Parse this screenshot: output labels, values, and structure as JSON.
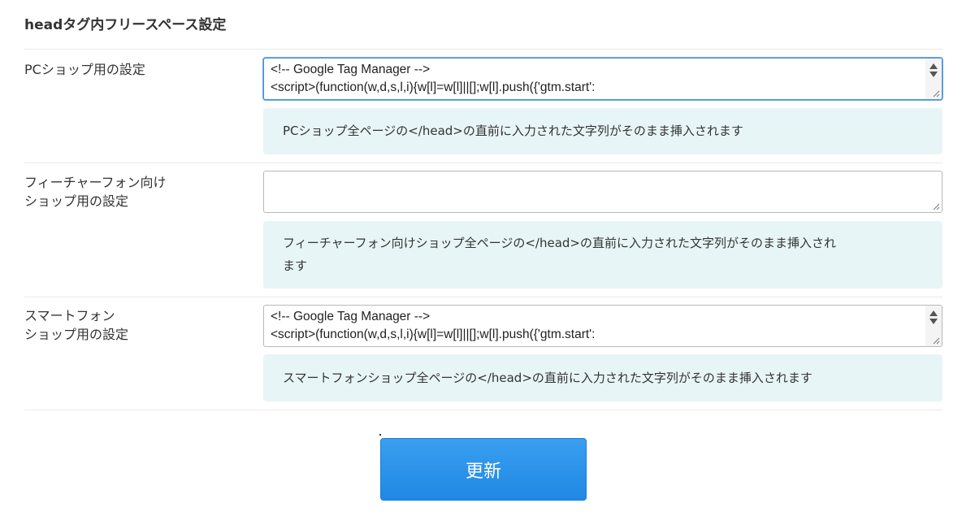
{
  "section": {
    "title": "headタグ内フリースペース設定"
  },
  "rows": [
    {
      "label": "PCショップ用の設定",
      "textarea_lines": [
        "<!-- Google Tag Manager -->",
        "<script>(function(w,d,s,l,i){w[l]=w[l]||[];w[l].push({'gtm.start':"
      ],
      "help": "PCショップ全ページの</head>の直前に入力された文字列がそのまま挿入されます"
    },
    {
      "label": "フィーチャーフォン向け\nショップ用の設定",
      "textarea_lines": [],
      "help_lines": [
        "フィーチャーフォン向けショップ全ページの</head>の直前に入力された文字列がそのまま挿入され",
        "ます"
      ]
    },
    {
      "label": "スマートフォン\nショップ用の設定",
      "textarea_lines": [
        "<!-- Google Tag Manager -->",
        "<script>(function(w,d,s,l,i){w[l]=w[l]||[];w[l].push({'gtm.start':"
      ],
      "help": "スマートフォンショップ全ページの</head>の直前に入力された文字列がそのまま挿入されます"
    }
  ],
  "submit": {
    "label": "更新"
  },
  "colors": {
    "accent": "#2b93ea",
    "help_bg": "#e8f5f6",
    "focus_border": "#4a90d9"
  },
  "icons": {
    "scroll_up": "triangle-up",
    "scroll_down": "triangle-down",
    "resize": "resize-grip"
  }
}
